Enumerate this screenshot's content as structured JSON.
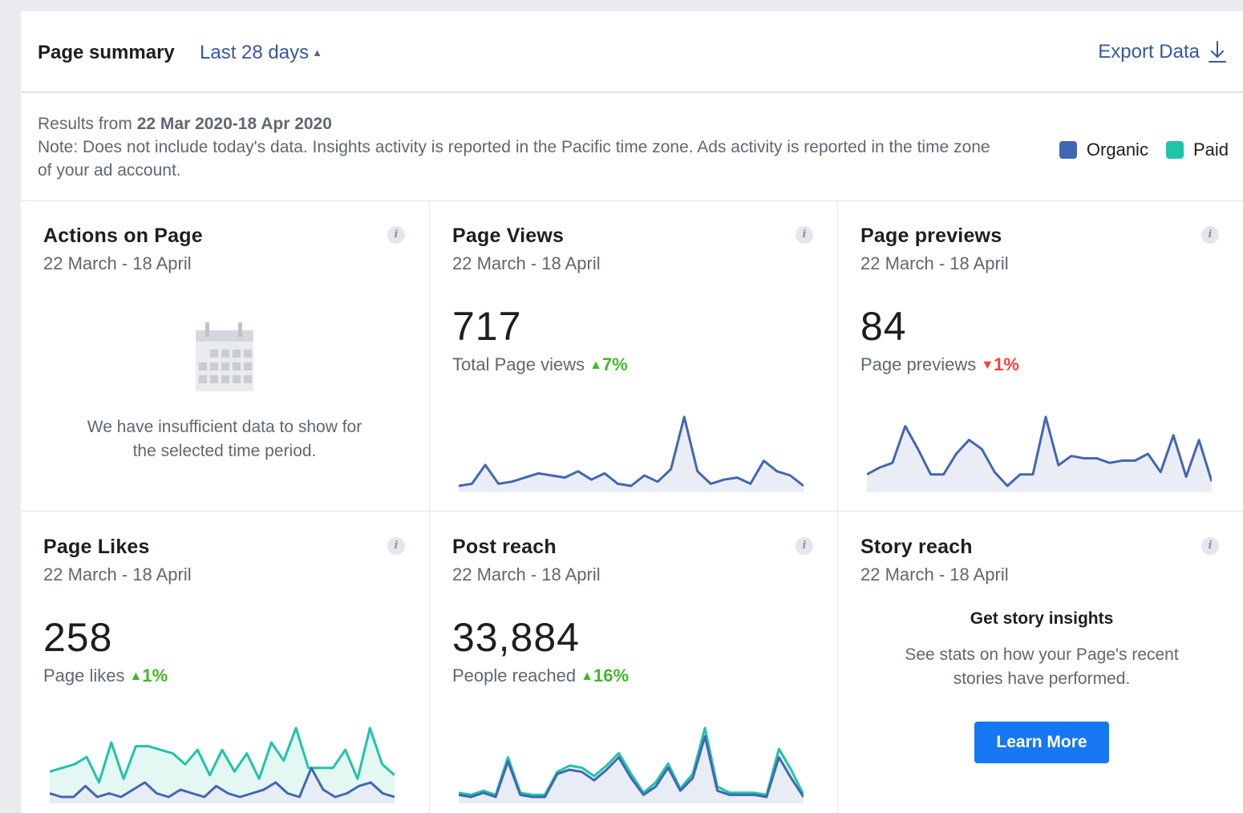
{
  "header": {
    "title": "Page summary",
    "range": "Last 28 days",
    "export": "Export Data"
  },
  "info": {
    "results_prefix": "Results from",
    "results_range": "22 Mar 2020-18 Apr 2020",
    "note": "Note: Does not include today's data. Insights activity is reported in the Pacific time zone. Ads activity is reported in the time zone of your ad account."
  },
  "legend": [
    {
      "label": "Organic",
      "color": "#4267b2"
    },
    {
      "label": "Paid",
      "color": "#20c4a8"
    }
  ],
  "cards": {
    "actions": {
      "title": "Actions on Page",
      "date": "22 March - 18 April",
      "empty_line1": "We have insufficient data to show for",
      "empty_line2": "the selected time period."
    },
    "views": {
      "title": "Page Views",
      "date": "22 March - 18 April",
      "value": "717",
      "label": "Total Page views",
      "delta": "7%",
      "direction": "up"
    },
    "previews": {
      "title": "Page previews",
      "date": "22 March - 18 April",
      "value": "84",
      "label": "Page previews",
      "delta": "1%",
      "direction": "down"
    },
    "likes": {
      "title": "Page Likes",
      "date": "22 March - 18 April",
      "value": "258",
      "label": "Page likes",
      "delta": "1%",
      "direction": "up"
    },
    "reach": {
      "title": "Post reach",
      "date": "22 March - 18 April",
      "value": "33,884",
      "label": "People reached",
      "delta": "16%",
      "direction": "up"
    },
    "story": {
      "title": "Story reach",
      "date": "22 March - 18 April",
      "heading": "Get story insights",
      "text_line1": "See stats on how your Page's recent",
      "text_line2": "stories have performed.",
      "button": "Learn More"
    }
  },
  "chart_data": [
    {
      "type": "area",
      "name": "page-views",
      "series": [
        {
          "values": [
            2,
            3,
            12,
            3,
            4,
            6,
            8,
            7,
            6,
            9,
            5,
            8,
            3,
            2,
            7,
            4,
            10,
            35,
            9,
            3,
            5,
            6,
            3,
            14,
            9,
            7,
            2
          ]
        }
      ]
    },
    {
      "type": "area",
      "name": "page-previews",
      "series": [
        {
          "values": [
            1,
            4,
            6,
            22,
            12,
            1,
            1,
            10,
            16,
            12,
            2,
            -4,
            1,
            1,
            26,
            5,
            9,
            8,
            8,
            6,
            7,
            7,
            10,
            2,
            18,
            0,
            16,
            -2
          ]
        }
      ]
    },
    {
      "type": "area",
      "name": "page-likes",
      "series": [
        {
          "values": [
            2,
            1,
            1,
            4,
            1,
            2,
            1,
            3,
            5,
            2,
            1,
            3,
            2,
            1,
            4,
            2,
            1,
            2,
            3,
            5,
            2,
            1,
            9,
            3,
            1,
            2,
            4,
            5,
            2,
            1
          ]
        },
        {
          "values": [
            8,
            9,
            10,
            12,
            5,
            16,
            6,
            15,
            15,
            14,
            13,
            10,
            14,
            7,
            14,
            8,
            13,
            6,
            16,
            11,
            20,
            9,
            9,
            9,
            14,
            6,
            20,
            10,
            7
          ]
        }
      ]
    },
    {
      "type": "area",
      "name": "post-reach",
      "series": [
        {
          "values": [
            2,
            1,
            3,
            1,
            18,
            2,
            1,
            1,
            12,
            14,
            13,
            9,
            14,
            20,
            10,
            2,
            6,
            15,
            4,
            10,
            30,
            4,
            2,
            2,
            2,
            1,
            20,
            10,
            1
          ]
        },
        {
          "values": [
            3,
            2,
            4,
            2,
            20,
            3,
            2,
            2,
            13,
            16,
            15,
            11,
            16,
            22,
            12,
            3,
            8,
            17,
            5,
            12,
            34,
            6,
            3,
            3,
            3,
            2,
            24,
            14,
            2
          ]
        }
      ]
    }
  ]
}
